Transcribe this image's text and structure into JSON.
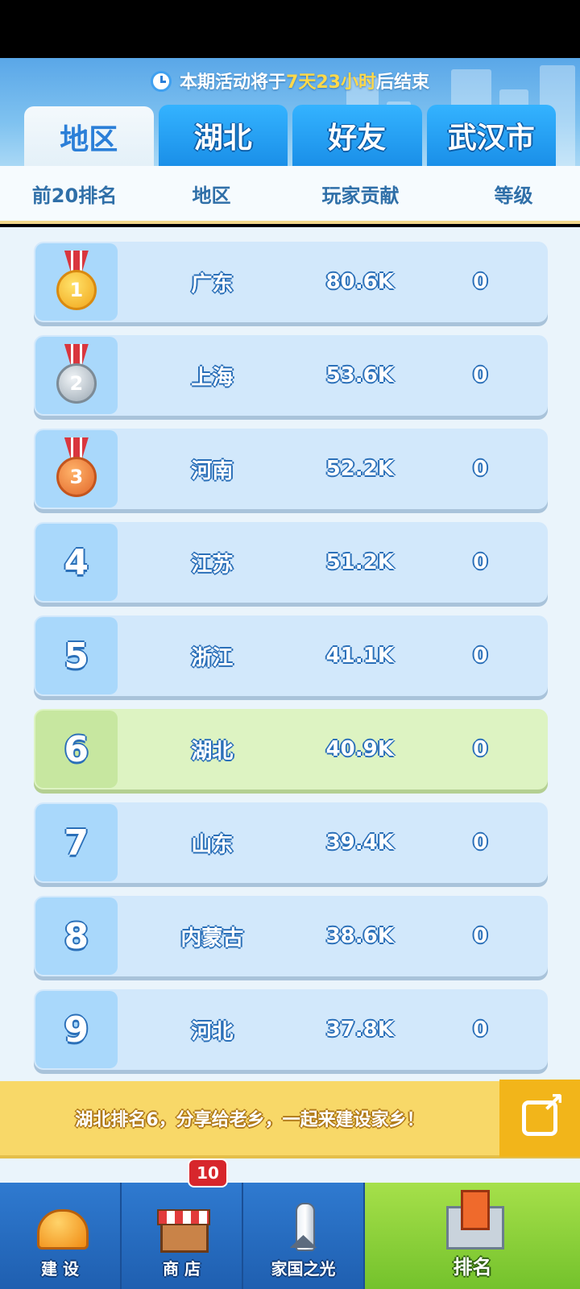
{
  "countdown": {
    "prefix": "本期活动将于",
    "highlight": "7天23小时",
    "suffix": "后结束"
  },
  "tabs": [
    {
      "label": "地区",
      "active": true
    },
    {
      "label": "湖北",
      "active": false
    },
    {
      "label": "好友",
      "active": false
    },
    {
      "label": "武汉市",
      "active": false
    }
  ],
  "header": {
    "rank": "前20排名",
    "region": "地区",
    "contribution": "玩家贡献",
    "level": "等级"
  },
  "rows": [
    {
      "rank": "1",
      "medal": "gold",
      "region": "广东",
      "contribution": "80.6K",
      "level": "0"
    },
    {
      "rank": "2",
      "medal": "silver",
      "region": "上海",
      "contribution": "53.6K",
      "level": "0"
    },
    {
      "rank": "3",
      "medal": "bronze",
      "region": "河南",
      "contribution": "52.2K",
      "level": "0"
    },
    {
      "rank": "4",
      "region": "江苏",
      "contribution": "51.2K",
      "level": "0"
    },
    {
      "rank": "5",
      "region": "浙江",
      "contribution": "41.1K",
      "level": "0"
    },
    {
      "rank": "6",
      "region": "湖北",
      "contribution": "40.9K",
      "level": "0",
      "mine": true
    },
    {
      "rank": "7",
      "region": "山东",
      "contribution": "39.4K",
      "level": "0"
    },
    {
      "rank": "8",
      "region": "内蒙古",
      "contribution": "38.6K",
      "level": "0"
    },
    {
      "rank": "9",
      "region": "河北",
      "contribution": "37.8K",
      "level": "0"
    }
  ],
  "share": {
    "text": "湖北排名6，分享给老乡，一起来建设家乡！",
    "icon": "share-icon"
  },
  "nav": {
    "build": {
      "label": "建 设",
      "icon": "helmet-icon"
    },
    "shop": {
      "label": "商 店",
      "icon": "shop-icon",
      "badge": "10"
    },
    "glory": {
      "label": "家国之光",
      "icon": "rocket-icon"
    },
    "ranking": {
      "label": "排名",
      "icon": "trophy-icon"
    }
  },
  "colors": {
    "accent": "#1a8fe8",
    "highlight_row": "#ddf3c2",
    "share_bar": "#f8d868",
    "countdown_highlight": "#ffd84a"
  }
}
